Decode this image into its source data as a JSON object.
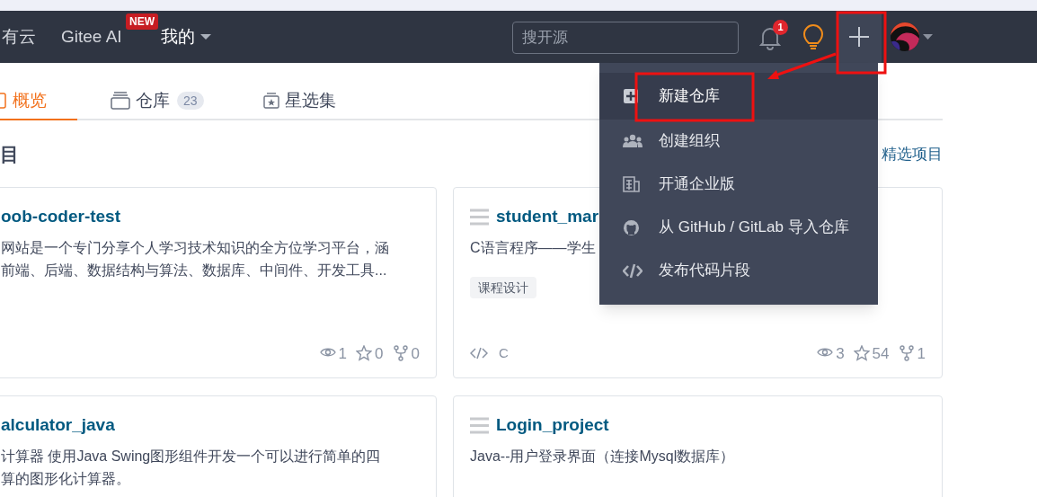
{
  "navbar": {
    "links": [
      {
        "label": "有云",
        "kind": "link"
      },
      {
        "label": "Gitee AI",
        "kind": "link",
        "badge": "NEW"
      },
      {
        "label": "我的",
        "kind": "dropdown"
      }
    ],
    "search": {
      "placeholder": "搜开源"
    },
    "notifications": {
      "count": "1"
    }
  },
  "tabs": [
    {
      "label": "概览",
      "selected": true,
      "kind": "overview"
    },
    {
      "label": "仓库",
      "selected": false,
      "kind": "repo",
      "count": "23"
    },
    {
      "label": "星选集",
      "selected": false,
      "kind": "collection"
    }
  ],
  "section": {
    "title": "目",
    "link": "精选项目"
  },
  "cards": [
    {
      "title": "oob-coder-test",
      "show_icon": false,
      "description": [
        "网站是一个专门分享个人学习技术知识的全方位学习平台，涵",
        "前端、后端、数据结构与算法、数据库、中间件、开发工具..."
      ],
      "watch": "1",
      "stars": "0",
      "forks": "0"
    },
    {
      "title": "student_mar",
      "show_icon": true,
      "description": [
        "C语言程序——学生"
      ],
      "tag": "课程设计",
      "language": "C",
      "watch": "3",
      "stars": "54",
      "forks": "1"
    },
    {
      "title": "alculator_java",
      "show_icon": false,
      "description": [
        "计算器 使用Java Swing图形组件开发一个可以进行简单的四",
        "算的图形化计算器。"
      ]
    },
    {
      "title": "Login_project",
      "show_icon": true,
      "description": [
        "Java--用户登录界面（连接Mysql数据库）"
      ]
    }
  ],
  "create_menu": [
    {
      "label": "新建仓库",
      "kind": "new-repo",
      "selected": true
    },
    {
      "label": "创建组织",
      "kind": "organization",
      "selected": false
    },
    {
      "label": "开通企业版",
      "kind": "enterprise",
      "selected": false
    },
    {
      "label": "从 GitHub / GitLab 导入仓库",
      "kind": "import",
      "selected": false
    },
    {
      "label": "发布代码片段",
      "kind": "snippet",
      "selected": false
    }
  ]
}
